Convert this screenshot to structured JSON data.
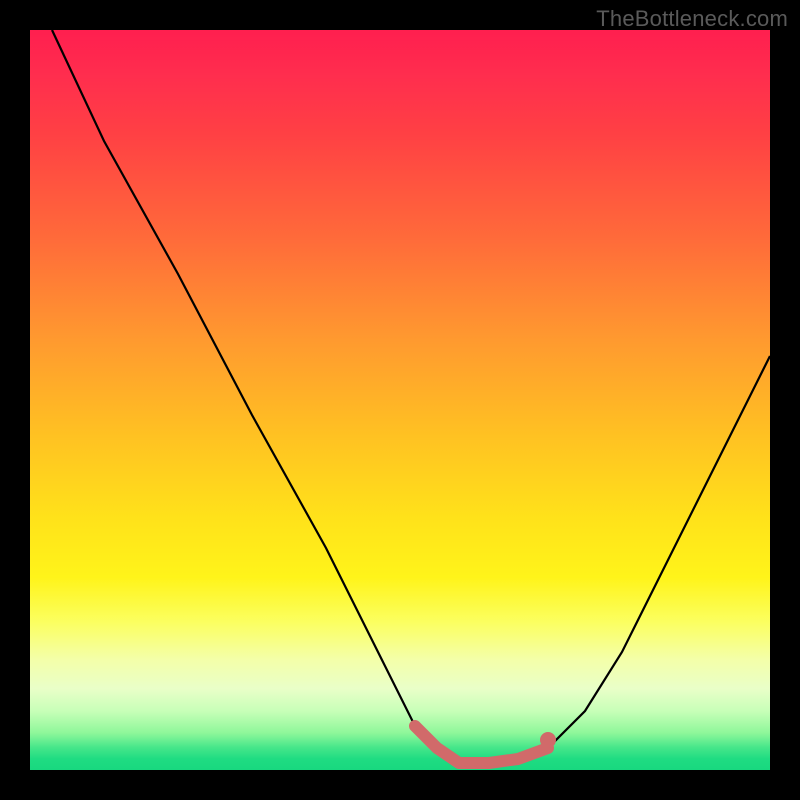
{
  "watermark": "TheBottleneck.com",
  "chart_data": {
    "type": "line",
    "title": "",
    "xlabel": "",
    "ylabel": "",
    "xlim": [
      0,
      100
    ],
    "ylim": [
      0,
      100
    ],
    "grid": false,
    "legend": false,
    "series": [
      {
        "name": "bottleneck-curve",
        "color": "#000000",
        "x": [
          3,
          10,
          20,
          30,
          40,
          48,
          52,
          55,
          58,
          62,
          66,
          70,
          75,
          80,
          85,
          90,
          95,
          100
        ],
        "values": [
          100,
          85,
          67,
          48,
          30,
          14,
          6,
          3,
          1,
          1,
          1.5,
          3,
          8,
          16,
          26,
          36,
          46,
          56
        ]
      },
      {
        "name": "highlight-band",
        "color": "#d16a6a",
        "x": [
          52,
          55,
          58,
          62,
          66,
          70
        ],
        "values": [
          6,
          3,
          1,
          1,
          1.5,
          3
        ]
      }
    ],
    "markers": [
      {
        "name": "highlight-dot",
        "x": 70,
        "y": 4,
        "color": "#d16a6a"
      }
    ]
  }
}
